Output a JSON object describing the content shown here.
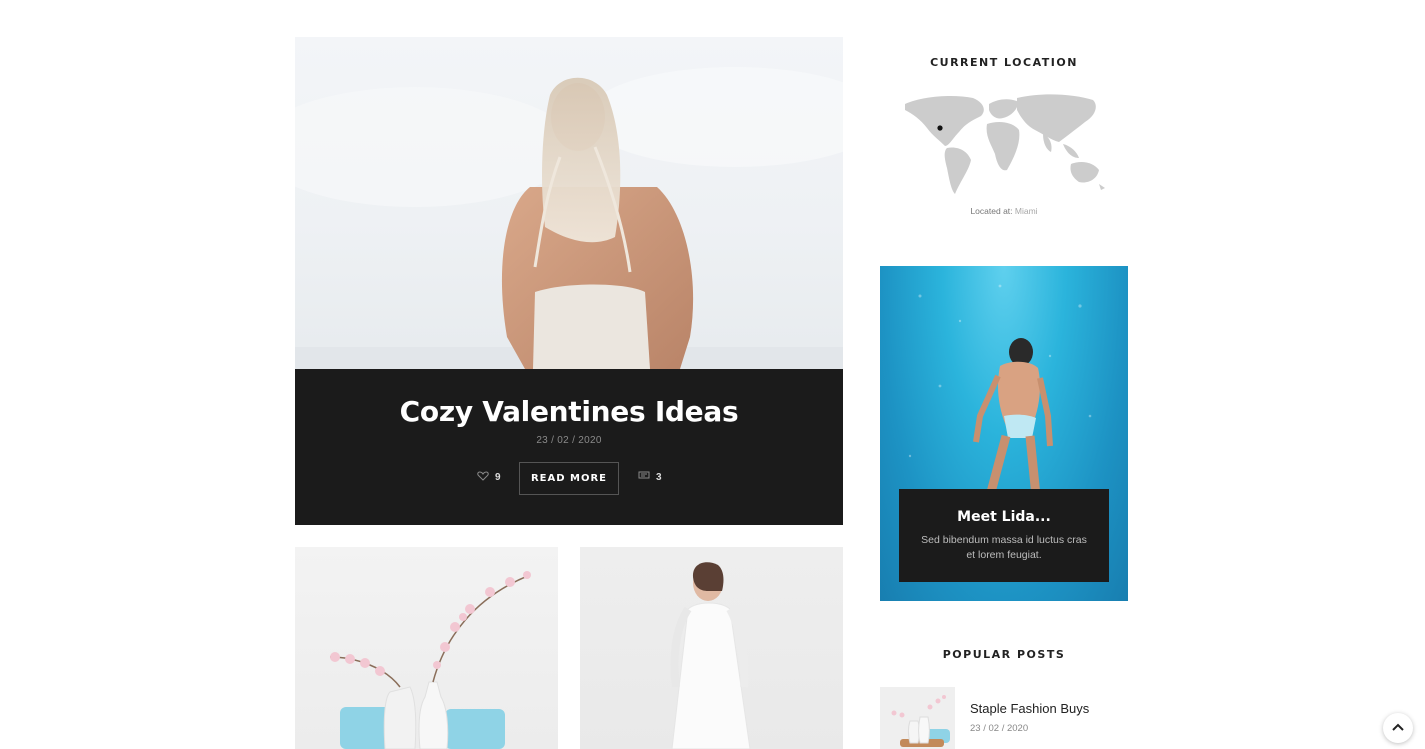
{
  "featured": {
    "title": "Cozy Valentines Ideas",
    "date": "23  / 02  / 2020",
    "likes": "9",
    "read_more": "READ MORE",
    "comments": "3"
  },
  "sidebar": {
    "location": {
      "title": "CURRENT LOCATION",
      "caption_prefix": "Located at: ",
      "city": "Miami"
    },
    "about": {
      "title": "Meet Lida...",
      "text": "Sed bibendum massa id luctus cras et lorem feugiat."
    },
    "popular": {
      "title": "POPULAR POSTS",
      "items": [
        {
          "title": "Staple Fashion Buys",
          "date": "23  / 02  / 2020"
        }
      ]
    }
  },
  "colors": {
    "dark_box": "#1b1b1b",
    "map_land": "#cccccc",
    "accent_water": "#2bb4dc"
  },
  "icons": {
    "like": "heart-icon",
    "comments": "comment-icon",
    "scroll_top": "chevron-up-icon"
  }
}
